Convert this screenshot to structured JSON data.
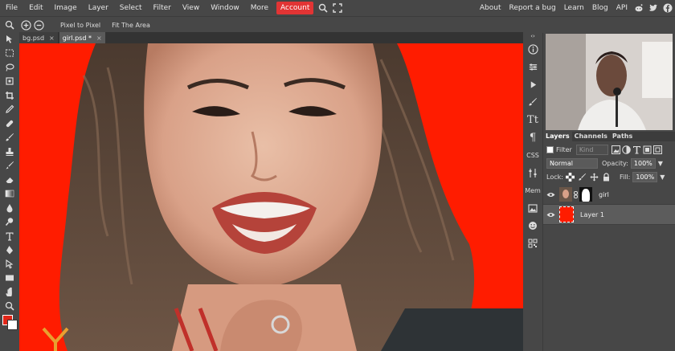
{
  "menubar": {
    "items": [
      "File",
      "Edit",
      "Image",
      "Layer",
      "Select",
      "Filter",
      "View",
      "Window",
      "More"
    ],
    "account": "Account",
    "links": [
      "About",
      "Report a bug",
      "Learn",
      "Blog",
      "API"
    ]
  },
  "options": {
    "pixel_to_pixel": "Pixel to Pixel",
    "fit_area": "Fit The Area"
  },
  "tabs": [
    {
      "label": "bg.psd",
      "close": "×"
    },
    {
      "label": "girl.psd *",
      "close": "×"
    }
  ],
  "right_strip": {
    "css": "CSS",
    "mem": "Mem"
  },
  "layers_panel": {
    "tabs": [
      "Layers",
      "Channels",
      "Paths"
    ],
    "filter_label": "Filter",
    "filter_select": "Kind",
    "blend_mode": "Normal",
    "opacity_label": "Opacity:",
    "opacity": "100%",
    "lock_label": "Lock:",
    "fill_label": "Fill:",
    "fill": "100%",
    "layers": [
      {
        "name": "girl"
      },
      {
        "name": "Layer 1"
      }
    ]
  },
  "colors": {
    "canvas_red": "#ff1c00",
    "account_red": "#e23434",
    "panel_bg": "#474747"
  }
}
